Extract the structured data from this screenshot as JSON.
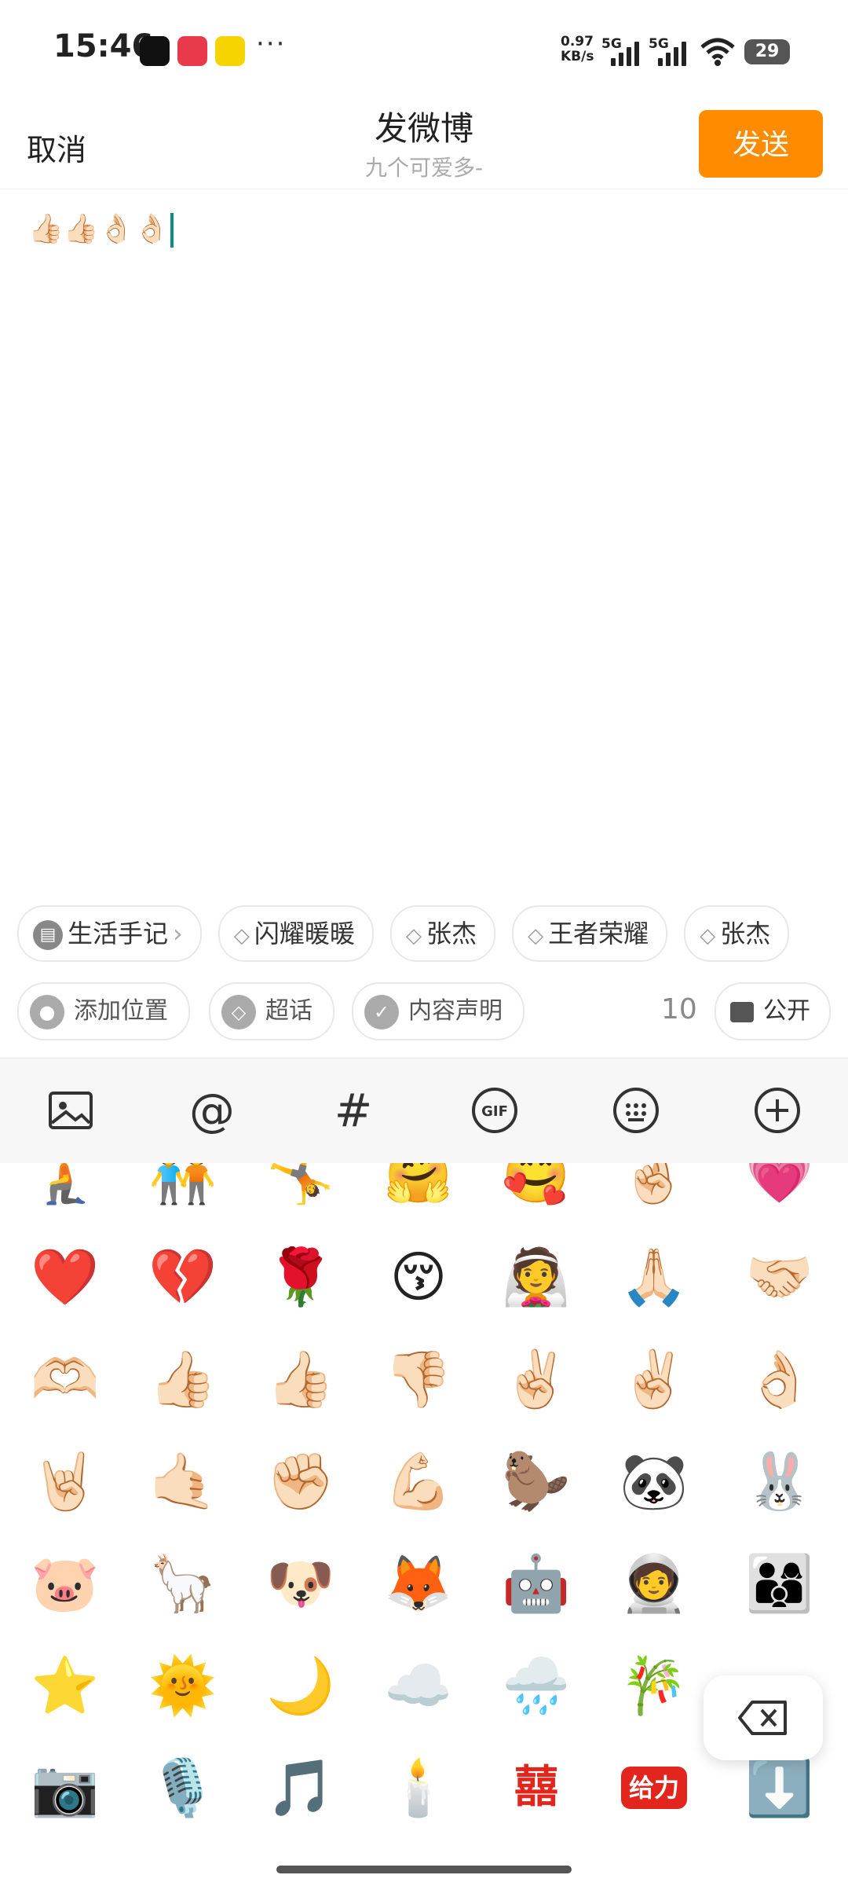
{
  "status_bar": {
    "time": "15:46",
    "net_speed_value": "0.97",
    "net_speed_unit": "KB/s",
    "sim1": "5G",
    "sim2": "5G",
    "battery": "29",
    "more_dots": "···"
  },
  "header": {
    "cancel": "取消",
    "title": "发微博",
    "subtitle": "九个可爱多-",
    "send": "发送"
  },
  "compose": {
    "text": "👍🏻👍🏻👌🏻👌🏻"
  },
  "topic_chips": [
    {
      "label": "生活手记",
      "icon": "note-icon"
    },
    {
      "label": "闪耀暖暖",
      "icon": "diamond-icon"
    },
    {
      "label": "张杰",
      "icon": "diamond-icon"
    },
    {
      "label": "王者荣耀",
      "icon": "diamond-icon"
    },
    {
      "label": "张杰",
      "icon": "diamond-icon"
    }
  ],
  "options": {
    "location": "添加位置",
    "super_topic": "超话",
    "content_statement": "内容声明",
    "count": "10",
    "visibility": "公开"
  },
  "toolbar": [
    "image-icon",
    "mention-icon",
    "hashtag-icon",
    "gif-icon",
    "emoji-keyboard-icon",
    "add-icon"
  ],
  "emoji_rows": [
    [
      "🧎",
      "🧑‍🤝‍🧑",
      "🤸",
      "🤗",
      "🥰",
      "🤞🏻",
      "💗"
    ],
    [
      "❤️",
      "💔",
      "🌹",
      "😚",
      "👰",
      "🙏🏻",
      "🤝🏻"
    ],
    [
      "🫶🏻",
      "👍🏻",
      "👍🏻",
      "👎🏻",
      "✌🏻",
      "✌🏻",
      "👌🏻"
    ],
    [
      "🤘🏻",
      "🤙🏻",
      "✊🏻",
      "💪🏻",
      "🦫",
      "🐼",
      "🐰"
    ],
    [
      "🐷",
      "🦙",
      "🐶",
      "🦊",
      "🤖",
      "🧑‍🚀",
      "👨‍👩‍👦"
    ],
    [
      "⭐",
      "🌞",
      "🌙",
      "☁️",
      "🌧️",
      "🎋",
      ""
    ],
    [
      "📷",
      "🎙️",
      "🎵",
      "🕯️",
      "囍",
      "给力",
      "⬇️"
    ]
  ]
}
